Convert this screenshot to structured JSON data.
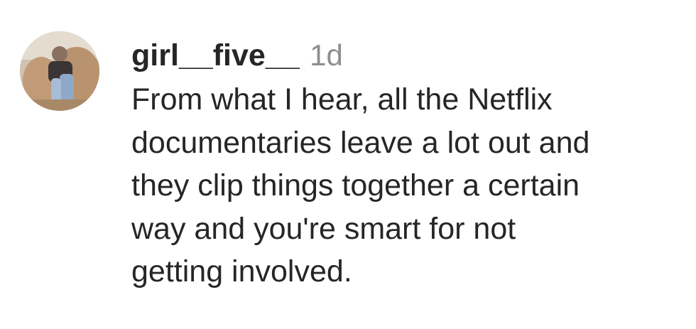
{
  "comment": {
    "username": "girl__five__",
    "time": "1d",
    "lines": [
      "From what I hear, all the Netflix",
      "documentaries leave a lot out and",
      "they clip things together a certain",
      "way and you're smart for not",
      "getting involved."
    ]
  }
}
